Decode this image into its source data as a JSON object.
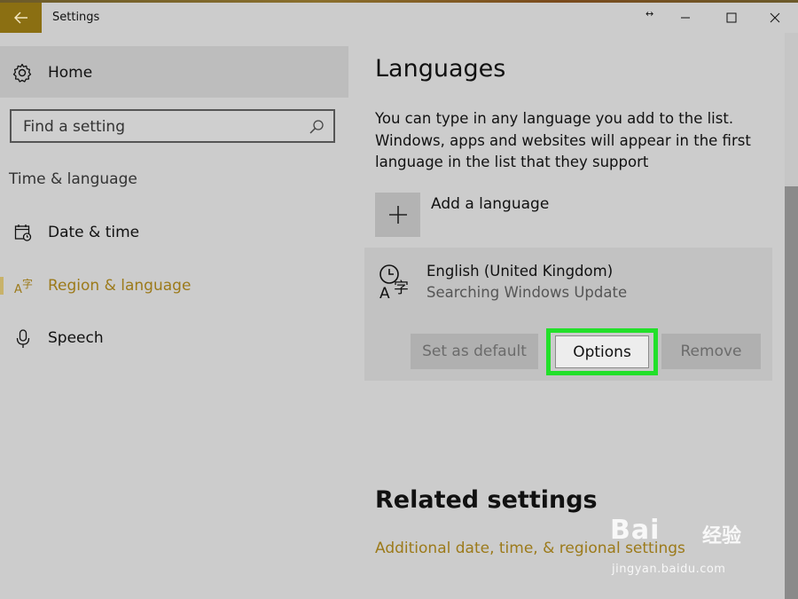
{
  "window": {
    "title": "Settings"
  },
  "sidebar": {
    "home_label": "Home",
    "search_placeholder": "Find a setting",
    "section_label": "Time & language",
    "items": [
      {
        "label": "Date & time",
        "icon": "calendar-clock-icon",
        "active": false
      },
      {
        "label": "Region & language",
        "icon": "language-icon",
        "active": true
      },
      {
        "label": "Speech",
        "icon": "microphone-icon",
        "active": false
      }
    ]
  },
  "main": {
    "title": "Languages",
    "description": "You can type in any language you add to the list. Windows, apps and websites will appear in the first language in the list that they support",
    "add_language_label": "Add a language",
    "language": {
      "name": "English (United Kingdom)",
      "status": "Searching Windows Update",
      "buttons": {
        "set_default": "Set as default",
        "options": "Options",
        "remove": "Remove"
      }
    },
    "related_title": "Related settings",
    "related_link": "Additional date, time, & regional settings"
  },
  "watermark": {
    "brand": "Bai",
    "brand_cn": "经验",
    "url": "jingyan.baidu.com"
  },
  "colors": {
    "accent": "#9c7a1a",
    "back_button": "#8b6f12",
    "highlight": "#22e02a",
    "background": "#cccccc"
  }
}
